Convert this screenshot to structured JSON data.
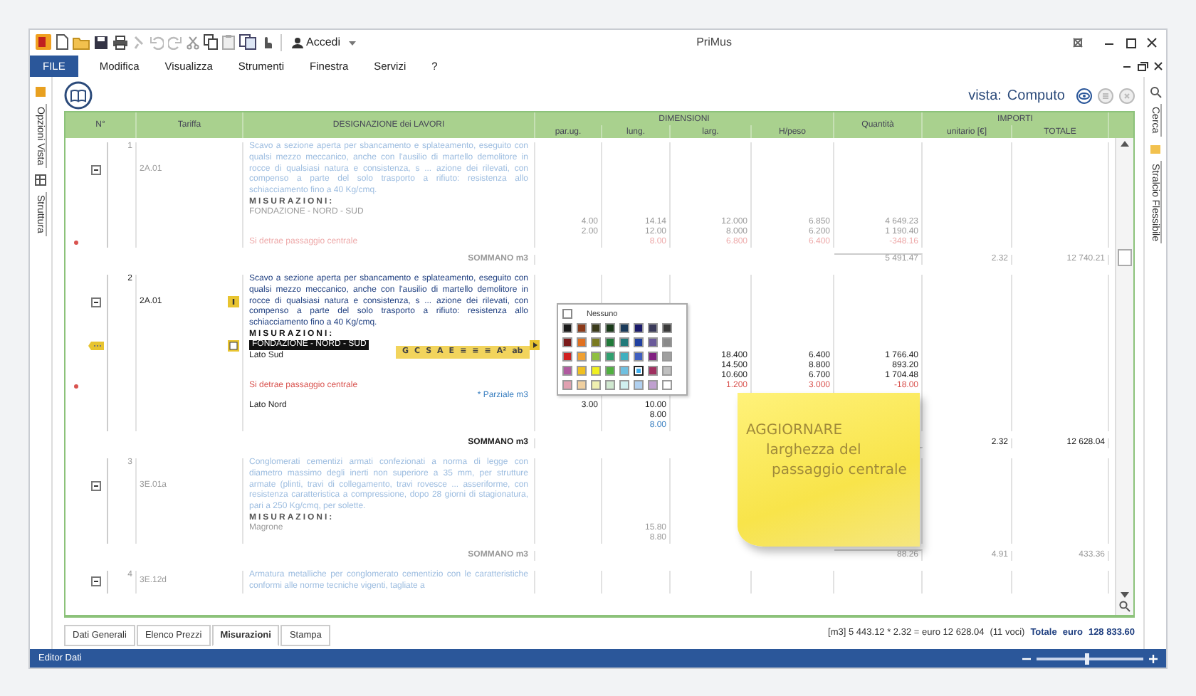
{
  "title_bar": {
    "app_name": "PriMus",
    "account_label": "Accedi"
  },
  "menu": [
    {
      "label": "FILE",
      "kind": "file"
    },
    {
      "label": "Modifica",
      "kind": "item"
    },
    {
      "label": "Visualizza",
      "kind": "item"
    },
    {
      "label": "Strumenti",
      "kind": "item"
    },
    {
      "label": "Finestra",
      "kind": "item"
    },
    {
      "label": "Servizi",
      "kind": "item"
    },
    {
      "label": "?",
      "kind": "item"
    }
  ],
  "side_left": [
    {
      "label": "Opzioni Vista"
    },
    {
      "label": "Struttura"
    }
  ],
  "side_right": [
    {
      "label": "Cerca"
    },
    {
      "label": "Stralcio Flessibile"
    }
  ],
  "view": {
    "label": "vista:",
    "value": "Computo"
  },
  "table": {
    "columns": {
      "number": "N°",
      "tariffa": "Tariffa",
      "designazione": "DESIGNAZIONE dei LAVORI",
      "dimensioni": "DIMENSIONI",
      "par_ug": "par.ug.",
      "lung": "lung.",
      "larg": "larg.",
      "h_peso": "H/peso",
      "quantita": "Quantità",
      "importi": "IMPORTI",
      "unitario": "unitario [€]",
      "totale": "TOTALE"
    },
    "records": [
      {
        "number": "1",
        "tariffa": "2A.01",
        "selected": false,
        "lines": [
          {
            "kind": "text",
            "text": "Scavo a sezione aperta per sbancamento e splateamento, eseguito con qualsi mezzo meccanico, anche con l'ausilio di martello demolitore in rocce di qualsiasi natura e consistenza, s ... azione dei rilevati, con compenso a parte del solo trasporto a rifiuto: resistenza allo schiacciamento fino a 40 Kg/cmq."
          },
          {
            "kind": "heading",
            "text": "MISURAZIONI:"
          },
          {
            "kind": "measure",
            "label": "FONDAZIONE - NORD - SUD"
          },
          {
            "kind": "measure",
            "par_ug": "4.00",
            "lung": "14.14",
            "larg": "12.000",
            "h_peso": "6.850",
            "quantita": "4 649.23"
          },
          {
            "kind": "measure",
            "par_ug": "2.00",
            "lung": "12.00",
            "larg": "8.000",
            "h_peso": "6.200",
            "quantita": "1 190.40"
          },
          {
            "kind": "deduction",
            "label": "Si detrae passaggio centrale",
            "lung": "8.00",
            "larg": "6.800",
            "h_peso": "6.400",
            "quantita": "-348.16"
          },
          {
            "kind": "sommano",
            "label": "SOMMANO m3",
            "quantita": "5 491.47",
            "unitario": "2.32",
            "totale": "12 740.21"
          }
        ]
      },
      {
        "number": "2",
        "tariffa": "2A.01",
        "selected": true,
        "lines": [
          {
            "kind": "text",
            "text": "Scavo a sezione aperta per sbancamento e splateamento, eseguito con qualsi mezzo meccanico, anche con l'ausilio di martello demolitore in rocce di qualsiasi natura e consistenza, s ... azione dei rilevati, con compenso a parte del solo trasporto a rifiuto: resistenza allo schiacciamento fino a 40 Kg/cmq."
          },
          {
            "kind": "heading",
            "text": "MISURAZIONI:"
          },
          {
            "kind": "editing",
            "label": "FONDAZIONE - NORD - SUD"
          },
          {
            "kind": "measure",
            "label": "Lato Sud",
            "larg": "18.400",
            "h_peso": "6.400",
            "quantita": "1 766.40"
          },
          {
            "kind": "measure",
            "larg": "14.500",
            "h_peso": "8.800",
            "quantita": "893.20"
          },
          {
            "kind": "measure",
            "larg": "10.600",
            "h_peso": "6.700",
            "quantita": "1 704.48"
          },
          {
            "kind": "deduction",
            "label": "Si detrae passaggio centrale",
            "larg": "1.200",
            "h_peso": "3.000",
            "quantita": "-18.00"
          },
          {
            "kind": "partial",
            "label": "* Parziale m3"
          },
          {
            "kind": "measure",
            "label": "Lato Nord",
            "par_ug": "3.00",
            "lung": "10.00"
          },
          {
            "kind": "measure",
            "lung": "8.00"
          },
          {
            "kind": "linked",
            "lung": "8.00"
          },
          {
            "kind": "sommano",
            "label": "SOMMANO m3",
            "unitario": "2.32",
            "totale": "12 628.04"
          }
        ]
      },
      {
        "number": "3",
        "tariffa": "3E.01a",
        "selected": false,
        "lines": [
          {
            "kind": "text",
            "text": "Conglomerati cementizi armati confezionati a norma di legge con diametro massimo degli inerti non superiore a 35 mm, per strutture armate (plinti, travi di collegamento, travi rovesce ... asseriforme, con resistenza caratteristica a compressione, dopo 28 giorni di stagionatura, pari a 250 Kg/cmq, per solette."
          },
          {
            "kind": "heading",
            "text": "MISURAZIONI:"
          },
          {
            "kind": "measure",
            "label": "Magrone",
            "lung": "15.80"
          },
          {
            "kind": "measure",
            "lung": "8.80"
          },
          {
            "kind": "sommano",
            "label": "SOMMANO m3",
            "quantita": "88.26",
            "unitario": "4.91",
            "totale": "433.36"
          }
        ]
      },
      {
        "number": "4",
        "tariffa": "3E.12d",
        "selected": false,
        "lines": [
          {
            "kind": "text",
            "text": "Armatura metalliche per conglomerato cementizio con le caratteristiche conformi alle norme tecniche vigenti, tagliate a"
          }
        ]
      }
    ]
  },
  "color_picker": {
    "none_label": "Nessuno",
    "swatches": [
      {
        "color": "#1a1a1a",
        "selected": false
      },
      {
        "color": "#8b3a1a",
        "selected": false
      },
      {
        "color": "#3a3a1a",
        "selected": false
      },
      {
        "color": "#1a3a1a",
        "selected": false
      },
      {
        "color": "#1a3a5a",
        "selected": false
      },
      {
        "color": "#1a1a6a",
        "selected": false
      },
      {
        "color": "#3a3a5a",
        "selected": false
      },
      {
        "color": "#3a3a3a",
        "selected": false
      },
      {
        "color": "#7a1a1a",
        "selected": false
      },
      {
        "color": "#e07020",
        "selected": false
      },
      {
        "color": "#7a7a20",
        "selected": false
      },
      {
        "color": "#207a3a",
        "selected": false
      },
      {
        "color": "#207a7a",
        "selected": false
      },
      {
        "color": "#2040a0",
        "selected": false
      },
      {
        "color": "#6a5a9a",
        "selected": false
      },
      {
        "color": "#8a8a8a",
        "selected": false
      },
      {
        "color": "#d02020",
        "selected": false
      },
      {
        "color": "#f0a030",
        "selected": false
      },
      {
        "color": "#90c040",
        "selected": false
      },
      {
        "color": "#30a070",
        "selected": false
      },
      {
        "color": "#40b0c0",
        "selected": false
      },
      {
        "color": "#4060c0",
        "selected": false
      },
      {
        "color": "#802080",
        "selected": false
      },
      {
        "color": "#a0a0a0",
        "selected": false
      },
      {
        "color": "#b05aa0",
        "selected": false
      },
      {
        "color": "#f0c020",
        "selected": false
      },
      {
        "color": "#f0f020",
        "selected": false
      },
      {
        "color": "#50b040",
        "selected": false
      },
      {
        "color": "#70c0e0",
        "selected": false
      },
      {
        "color": "#40b0f0",
        "selected": true
      },
      {
        "color": "#a03060",
        "selected": false
      },
      {
        "color": "#c0c0c0",
        "selected": false
      },
      {
        "color": "#e0a0b0",
        "selected": false
      },
      {
        "color": "#f0d0a0",
        "selected": false
      },
      {
        "color": "#f0f0b0",
        "selected": false
      },
      {
        "color": "#d0e8d0",
        "selected": false
      },
      {
        "color": "#d0f0f0",
        "selected": false
      },
      {
        "color": "#b0d0f0",
        "selected": false
      },
      {
        "color": "#c0a0d0",
        "selected": false
      },
      {
        "color": "#ffffff",
        "selected": false
      }
    ]
  },
  "format_toolbar": {
    "buttons": [
      "G",
      "C",
      "S",
      "A",
      "E",
      "≡",
      "≡",
      "≡",
      "A²",
      "ab"
    ]
  },
  "sticky_note": {
    "lines": [
      "AGGIORNARE",
      "larghezza del",
      "passaggio centrale"
    ]
  },
  "sheet_tabs": [
    {
      "label": "Dati Generali",
      "selected": false
    },
    {
      "label": "Elenco Prezzi",
      "selected": false
    },
    {
      "label": "Misurazioni",
      "selected": true
    },
    {
      "label": "Stampa",
      "selected": false
    }
  ],
  "summary": {
    "formula": "[m3] 5 443.12 * 2.32 = euro 12 628.04",
    "count": "(11 voci)",
    "total_label": "Totale",
    "currency": "euro",
    "total": "128 833.60"
  },
  "status_bar": {
    "label": "Editor Dati",
    "zoom": {
      "level": 0.47
    }
  }
}
